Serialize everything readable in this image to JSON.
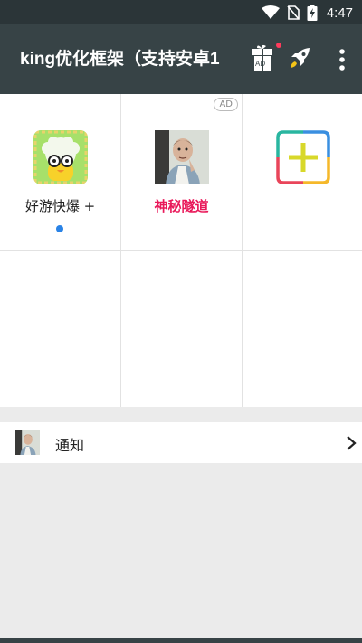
{
  "status_bar": {
    "time": "4:47",
    "icons": [
      "wifi-icon",
      "no-sim-icon",
      "battery-charging-icon"
    ]
  },
  "app_bar": {
    "title": "king优化框架（支持安卓1",
    "gift_badge": "AD",
    "actions": [
      "gift-icon",
      "rocket-icon",
      "more-vert-icon"
    ]
  },
  "grid": {
    "cells": [
      {
        "label": "好游快爆 +",
        "icon": "haoyoukuaibao-app-icon",
        "has_dot": true
      },
      {
        "label": "神秘隧道",
        "icon": "photo-avatar-icon",
        "ad": "AD",
        "highlight_color": "#e9195a"
      },
      {
        "label": "",
        "icon": "add-app-icon"
      }
    ]
  },
  "notice": {
    "label": "通知",
    "icon": "photo-avatar-icon"
  },
  "colors": {
    "app_bar": "#374346",
    "status_bar": "#2b3538",
    "accent_pink": "#e9195a",
    "dot_blue": "#2a83e6"
  }
}
